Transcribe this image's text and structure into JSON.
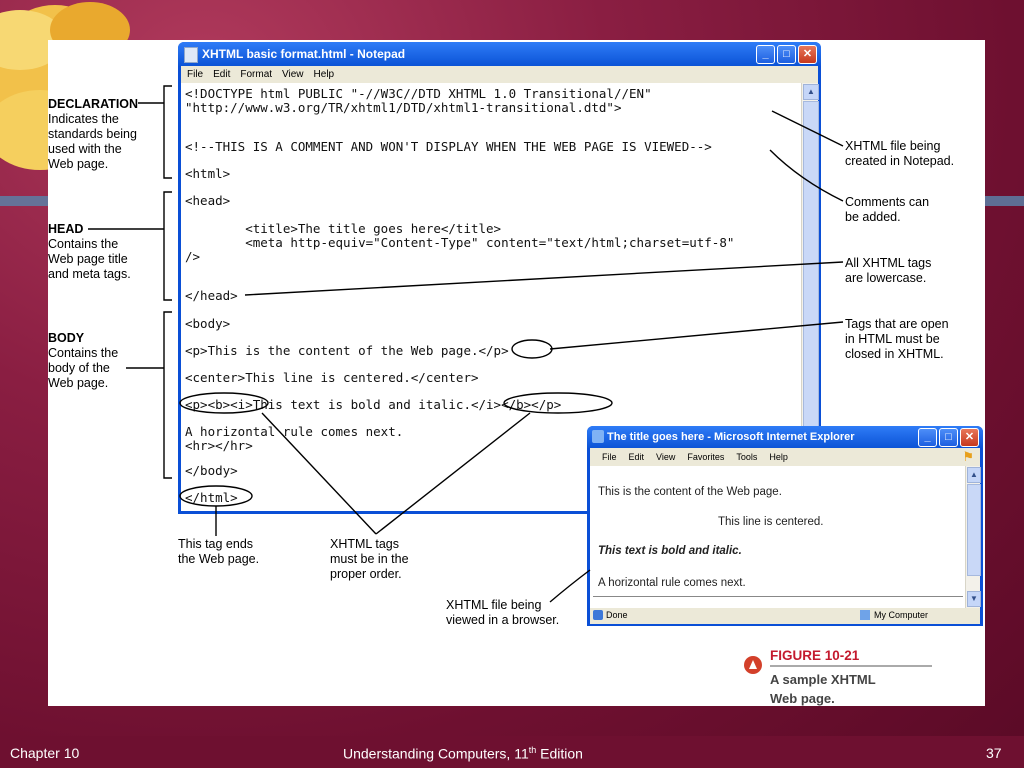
{
  "notepad": {
    "title": "XHTML basic format.html - Notepad",
    "menu": [
      "File",
      "Edit",
      "Format",
      "View",
      "Help"
    ],
    "code_lines": [
      "<!DOCTYPE html PUBLIC \"-//W3C//DTD XHTML 1.0 Transitional//EN\"",
      "\"http://www.w3.org/TR/xhtml1/DTD/xhtml1-transitional.dtd\">",
      "<!--THIS IS A COMMENT AND WON'T DISPLAY WHEN THE WEB PAGE IS VIEWED-->",
      "<html>",
      "<head>",
      "        <title>The title goes here</title>",
      "        <meta http-equiv=\"Content-Type\" content=\"text/html;charset=utf-8\"",
      "/>",
      "</head>",
      "<body>",
      "<p>This is the content of the Web page.</p>",
      "<center>This line is centered.</center>",
      "<p><b><i>This text is bold and italic.</i></b></p>",
      "A horizontal rule comes next.",
      "<hr></hr>",
      "</body>",
      "</html>"
    ]
  },
  "left_labels": {
    "declaration": {
      "title": "DECLARATION",
      "text": [
        "Indicates the",
        "standards being",
        "used with the",
        "Web page."
      ]
    },
    "head": {
      "title": "HEAD",
      "text": [
        "Contains the",
        "Web page title",
        "and meta tags."
      ]
    },
    "body": {
      "title": "BODY",
      "text": [
        "Contains the",
        "body of the",
        "Web page."
      ]
    }
  },
  "right_labels": {
    "notepad": [
      "XHTML file being",
      "created in Notepad."
    ],
    "comments": [
      "Comments can",
      "be added."
    ],
    "lowercase": [
      "All XHTML tags",
      "are lowercase."
    ],
    "closed": [
      "Tags that are open",
      "in HTML must be",
      "closed in XHTML."
    ]
  },
  "bottom_labels": {
    "ends": [
      "This tag ends",
      "the Web page."
    ],
    "order": [
      "XHTML tags",
      "must be in the",
      "proper order."
    ],
    "browser": [
      "XHTML file being",
      "viewed in a browser."
    ]
  },
  "ie": {
    "title": "The title goes here - Microsoft Internet Explorer",
    "menu": [
      "File",
      "Edit",
      "View",
      "Favorites",
      "Tools",
      "Help"
    ],
    "line1": "This is the content of the Web page.",
    "line2": "This line is centered.",
    "line3": "This text is bold and italic.",
    "line4": "A horizontal rule comes next.",
    "status_left": "Done",
    "status_right": "My Computer"
  },
  "figure": {
    "label": "FIGURE 10-21",
    "caption_line1": "A sample XHTML",
    "caption_line2": "Web page."
  },
  "footer": {
    "chapter": "Chapter 10",
    "book": "Understanding Computers, 11",
    "sup": "th",
    "edition": " Edition",
    "page": "37"
  },
  "colors": {
    "slide_bg": "#7a1535",
    "accent": "#c41a2e",
    "xp_blue": "#0b53d6"
  }
}
